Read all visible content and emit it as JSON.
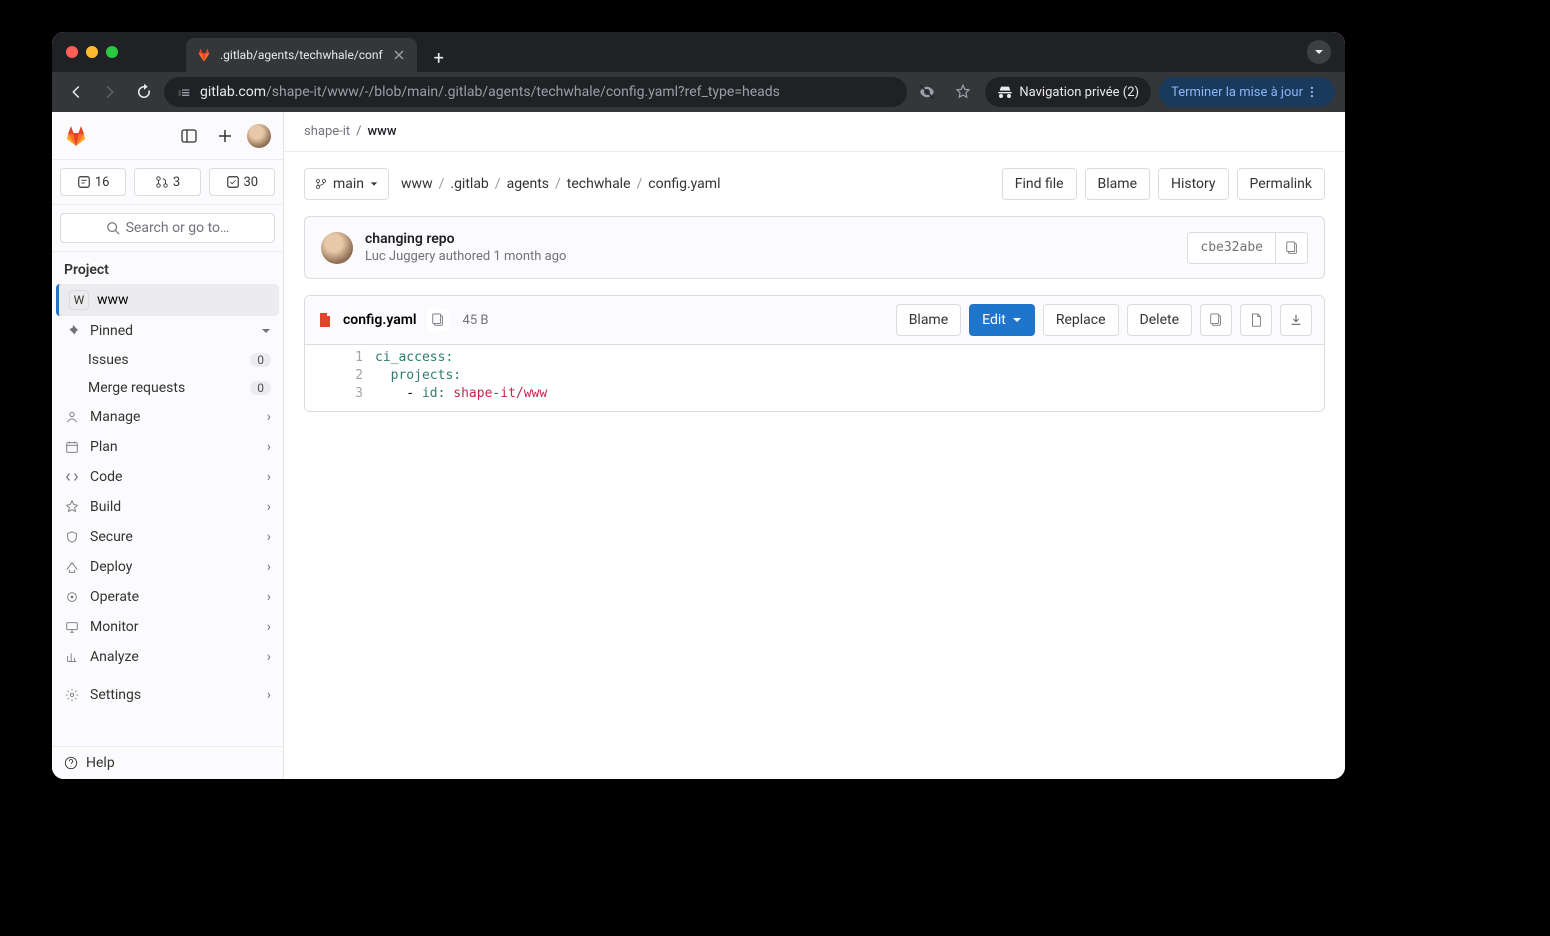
{
  "browser": {
    "tab_title": ".gitlab/agents/techwhale/conf",
    "url_host": "gitlab.com",
    "url_path": "/shape-it/www/-/blob/main/.gitlab/agents/techwhale/config.yaml?ref_type=heads",
    "incognito_label": "Navigation privée (2)",
    "update_label": "Terminer la mise à jour"
  },
  "sidebar": {
    "counts": {
      "issues": "16",
      "mr": "3",
      "todos": "30"
    },
    "search_placeholder": "Search or go to…",
    "section_label": "Project",
    "project_letter": "W",
    "project_name": "www",
    "pinned_label": "Pinned",
    "issues_label": "Issues",
    "issues_badge": "0",
    "mr_label": "Merge requests",
    "mr_badge": "0",
    "items": {
      "manage": "Manage",
      "plan": "Plan",
      "code": "Code",
      "build": "Build",
      "secure": "Secure",
      "deploy": "Deploy",
      "operate": "Operate",
      "monitor": "Monitor",
      "analyze": "Analyze",
      "settings": "Settings"
    },
    "help": "Help"
  },
  "breadcrumbs": {
    "group": "shape-it",
    "project": "www"
  },
  "file_nav": {
    "branch": "main",
    "path": [
      "www",
      ".gitlab",
      "agents",
      "techwhale",
      "config.yaml"
    ],
    "actions": {
      "find": "Find file",
      "blame": "Blame",
      "history": "History",
      "permalink": "Permalink"
    }
  },
  "commit": {
    "title": "changing repo",
    "author": "Luc Juggery",
    "authored": "authored",
    "time": "1 month ago",
    "sha": "cbe32abe"
  },
  "file": {
    "name": "config.yaml",
    "size": "45 B",
    "actions": {
      "blame": "Blame",
      "edit": "Edit",
      "replace": "Replace",
      "delete": "Delete"
    },
    "lines": [
      "1",
      "2",
      "3"
    ],
    "code": {
      "l1_key": "ci_access:",
      "l2_indent": "  ",
      "l2_key": "projects:",
      "l3_indent": "    - ",
      "l3_key": "id: ",
      "l3_val": "shape-it/www"
    }
  }
}
